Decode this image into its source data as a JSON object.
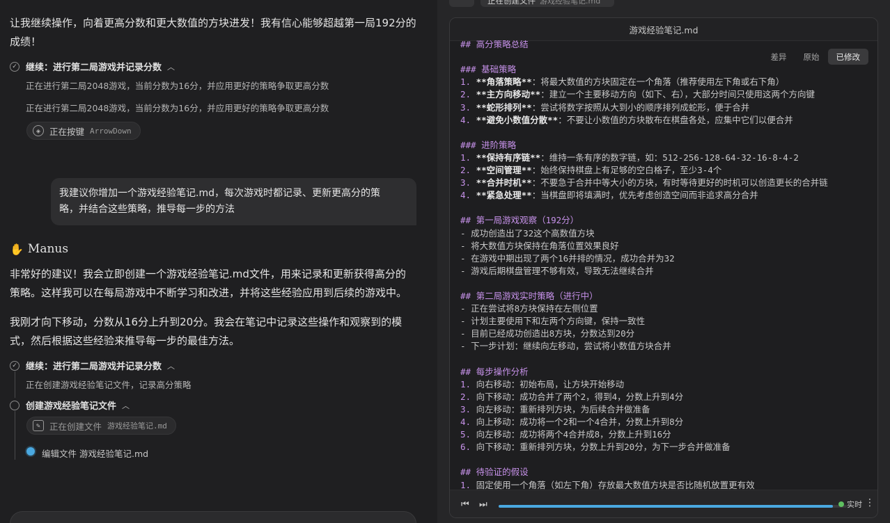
{
  "chat": {
    "intro_line1": "让我继续操作，向着更高分数和更大数值的方块进发！我有信心能够超越第一局192分的",
    "intro_line2": "成绩！",
    "step1": {
      "title": "继续：进行第二局游戏并记录分数",
      "sub1": "正在进行第二局2048游戏，当前分数为16分，并应用更好的策略争取更高分数",
      "sub2": "正在进行第二局2048游戏，当前分数为16分，并应用更好的策略争取更高分数",
      "pill_label": "正在按键",
      "pill_key": "ArrowDown"
    },
    "user_msg_line1": "我建议你增加一个游戏经验笔记.md，每次游戏时都记录、更新更高分的策",
    "user_msg_line2": "略，并结合这些策略，推导每一步的方法",
    "agent_name": "Manus",
    "reply1_line1": "非常好的建议！我会立即创建一个游戏经验笔记.md文件，用来记录和更新获得高分的",
    "reply1_line2": "策略。这样我可以在每局游戏中不断学习和改进，并将这些经验应用到后续的游戏中。",
    "reply2_line1": "我刚才向下移动，分数从16分上升到20分。我会在笔记中记录这些操作和观察到的模",
    "reply2_line2": "式，然后根据这些经验来推导每一步的最佳方法。",
    "step2": {
      "title": "继续：进行第二局游戏并记录分数",
      "sub": "正在创建游戏经验笔记文件，记录高分策略"
    },
    "step3": {
      "title": "创建游戏经验笔记文件",
      "pill_label": "正在创建文件",
      "pill_file": "游戏经验笔记.md",
      "edit_label": "编辑文件 游戏经验笔记.md"
    }
  },
  "editor": {
    "top_tab_label": "正在创建文件",
    "top_tab_file": "游戏经验笔记.md",
    "title": "游戏经验笔记.md",
    "tabs": [
      "差异",
      "原始",
      "已修改"
    ],
    "active_tab": "已修改",
    "lines": [
      {
        "p": "## ",
        "t": "高分策略总结"
      },
      {
        "p": "",
        "t": ""
      },
      {
        "p": "### ",
        "t": "基础策略"
      },
      {
        "p": "1. ",
        "bold": "**角落策略**",
        "t": "：将最大数值的方块固定在一个角落（推荐使用左下角或右下角）"
      },
      {
        "p": "2. ",
        "bold": "**主方向移动**",
        "t": "：建立一个主要移动方向（如下、右），大部分时间只使用这两个方向键"
      },
      {
        "p": "3. ",
        "bold": "**蛇形排列**",
        "t": "：尝试将数字按照从大到小的顺序排列成蛇形，便于合并"
      },
      {
        "p": "4. ",
        "bold": "**避免小数值分散**",
        "t": "：不要让小数值的方块散布在棋盘各处，应集中它们以便合并"
      },
      {
        "p": "",
        "t": ""
      },
      {
        "p": "### ",
        "t": "进阶策略"
      },
      {
        "p": "1. ",
        "bold": "**保持有序链**",
        "t": "：维持一条有序的数字链，如：512-256-128-64-32-16-8-4-2"
      },
      {
        "p": "2. ",
        "bold": "**空间管理**",
        "t": "：始终保持棋盘上有足够的空白格子，至少3-4个"
      },
      {
        "p": "3. ",
        "bold": "**合并时机**",
        "t": "：不要急于合并中等大小的方块，有时等待更好的时机可以创造更长的合并链"
      },
      {
        "p": "4. ",
        "bold": "**紧急处理**",
        "t": "：当棋盘即将填满时，优先考虑创造空间而非追求高分合并"
      },
      {
        "p": "",
        "t": ""
      },
      {
        "p": "## ",
        "t": "第一局游戏观察（192分）"
      },
      {
        "p": "- ",
        "t": "成功创造出了32这个高数值方块"
      },
      {
        "p": "- ",
        "t": "将大数值方块保持在角落位置效果良好"
      },
      {
        "p": "- ",
        "t": "在游戏中期出现了两个16并排的情况，成功合并为32"
      },
      {
        "p": "- ",
        "t": "游戏后期棋盘管理不够有效，导致无法继续合并"
      },
      {
        "p": "",
        "t": ""
      },
      {
        "p": "## ",
        "t": "第二局游戏实时策略（进行中）"
      },
      {
        "p": "- ",
        "t": "正在尝试将8方块保持在左侧位置"
      },
      {
        "p": "- ",
        "t": "计划主要使用下和左两个方向键，保持一致性"
      },
      {
        "p": "- ",
        "t": "目前已经成功创造出8方块，分数达到20分"
      },
      {
        "p": "- ",
        "t": "下一步计划：继续向左移动，尝试将小数值方块合并"
      },
      {
        "p": "",
        "t": ""
      },
      {
        "p": "## ",
        "t": "每步操作分析"
      },
      {
        "p": "1. ",
        "t": "向右移动：初始布局，让方块开始移动"
      },
      {
        "p": "2. ",
        "t": "向下移动：成功合并了两个2，得到4，分数上升到4分"
      },
      {
        "p": "3. ",
        "t": "向左移动：重新排列方块，为后续合并做准备"
      },
      {
        "p": "4. ",
        "t": "向上移动：成功将一个2和一个4合并，分数上升到8分"
      },
      {
        "p": "5. ",
        "t": "向左移动：成功将两个4合并成8，分数上升到16分"
      },
      {
        "p": "6. ",
        "t": "向下移动：重新排列方块，分数上升到20分，为下一步合并做准备"
      },
      {
        "p": "",
        "t": ""
      },
      {
        "p": "## ",
        "t": "待验证的假设"
      },
      {
        "p": "1. ",
        "t": "固定使用一个角落（如左下角）存放最大数值方块是否比随机放置更有效"
      }
    ],
    "player": {
      "prev_icon": "skip-back-icon",
      "next_icon": "skip-forward-icon",
      "progress": 0.96,
      "live_label": "实时"
    }
  }
}
